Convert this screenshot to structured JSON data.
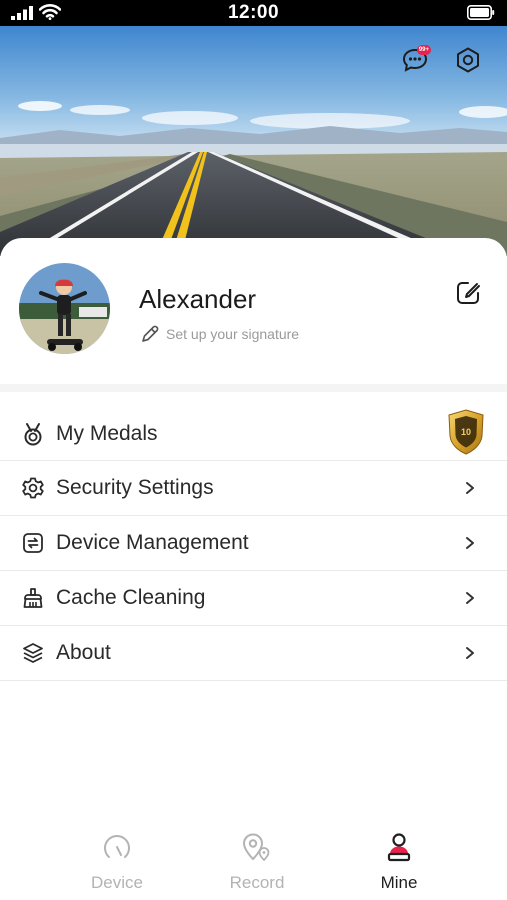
{
  "status_bar": {
    "time": "12:00"
  },
  "header": {
    "message_icon": "chat-bubble-icon",
    "message_badge": "99+",
    "settings_icon": "hexagon-settings-icon"
  },
  "profile": {
    "name": "Alexander",
    "signature_placeholder": "Set up your signature",
    "edit_icon": "edit-square-icon"
  },
  "menu": {
    "items": [
      {
        "label": "My Medals",
        "icon": "medal-icon",
        "badge_text": "10"
      },
      {
        "label": "Security Settings",
        "icon": "gear-icon"
      },
      {
        "label": "Device Management",
        "icon": "device-sync-icon"
      },
      {
        "label": "Cache Cleaning",
        "icon": "brush-icon"
      },
      {
        "label": "About",
        "icon": "layers-icon"
      }
    ]
  },
  "tab_bar": {
    "tabs": [
      {
        "label": "Device",
        "icon": "speedometer-icon",
        "active": false
      },
      {
        "label": "Record",
        "icon": "map-pin-icon",
        "active": false
      },
      {
        "label": "Mine",
        "icon": "person-icon",
        "active": true
      }
    ]
  },
  "colors": {
    "accent": "#e8224b",
    "text_primary": "#222222",
    "text_muted": "#9a9a9a",
    "tab_inactive": "#b3b3b3",
    "medal_gold": "#d9a42c"
  }
}
